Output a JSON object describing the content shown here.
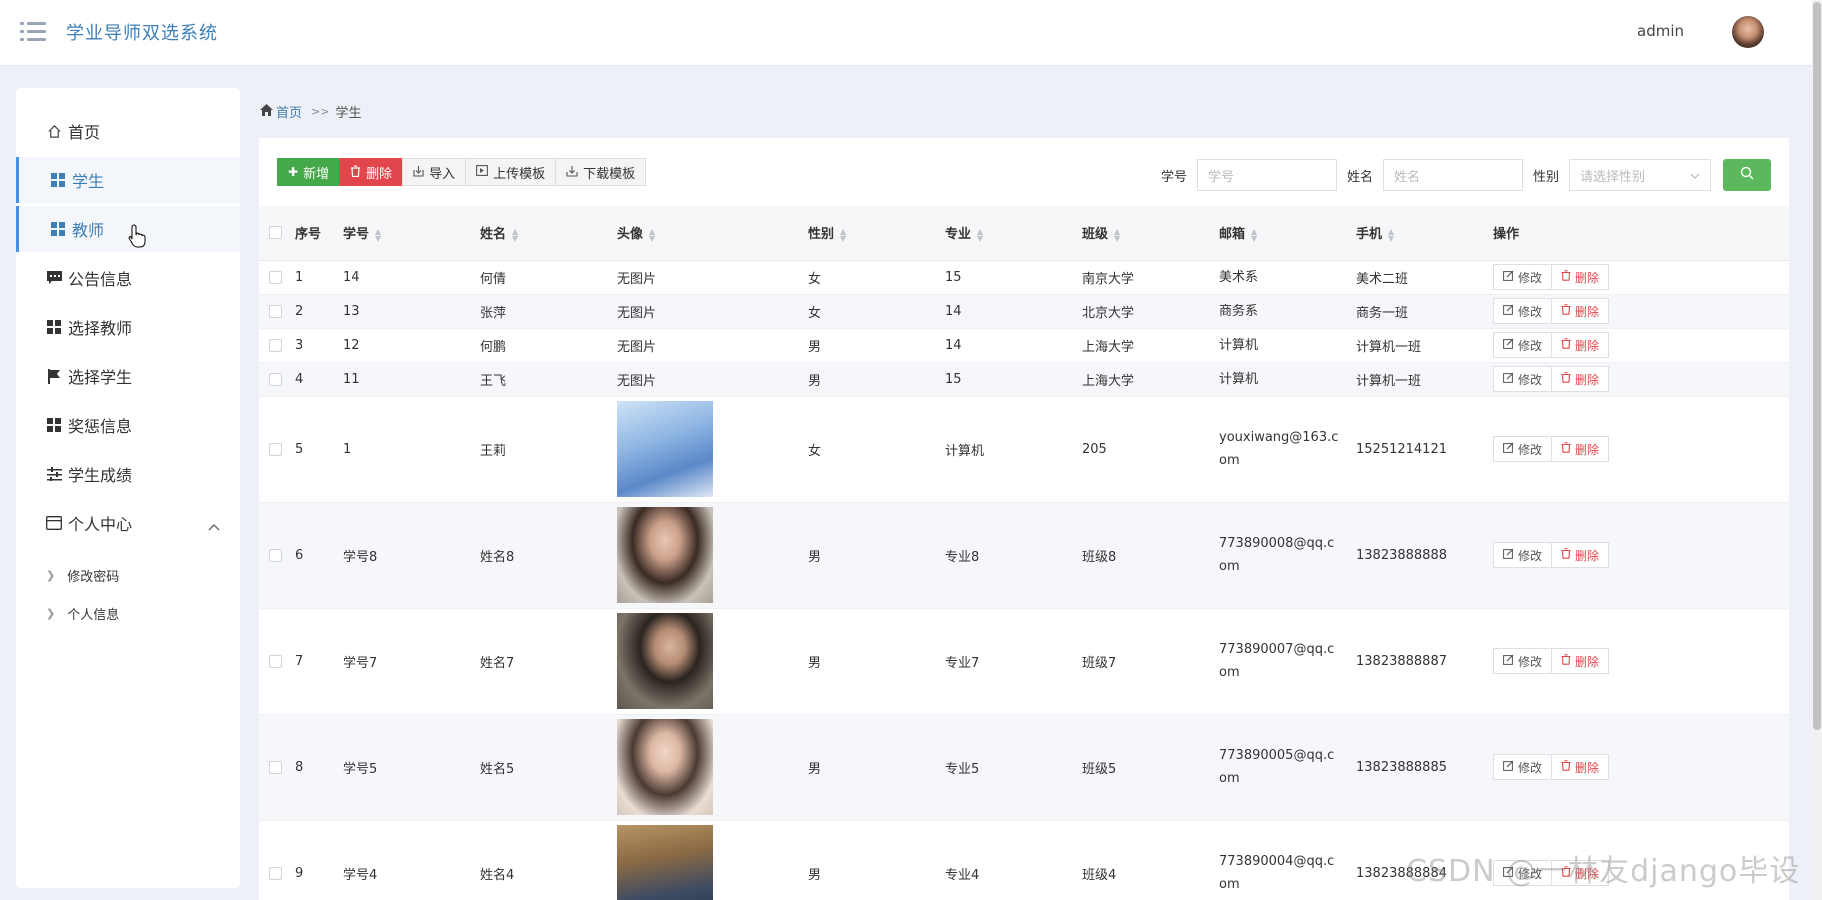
{
  "app": {
    "title": "学业导师双选系统",
    "user": "admin"
  },
  "sidebar": {
    "items": [
      {
        "label": "首页",
        "icon": "home-icon"
      },
      {
        "label": "学生",
        "icon": "grid-icon"
      },
      {
        "label": "教师",
        "icon": "grid-icon"
      },
      {
        "label": "公告信息",
        "icon": "comment-icon"
      },
      {
        "label": "选择教师",
        "icon": "grid-icon"
      },
      {
        "label": "选择学生",
        "icon": "flag-icon"
      },
      {
        "label": "奖惩信息",
        "icon": "grid-icon"
      },
      {
        "label": "学生成绩",
        "icon": "sliders-icon"
      },
      {
        "label": "个人中心",
        "icon": "card-icon"
      }
    ],
    "subitems": [
      "修改密码",
      "个人信息"
    ]
  },
  "breadcrumb": {
    "home": "首页",
    "sep": ">>",
    "current": "学生"
  },
  "toolbar": {
    "add": "新增",
    "delete": "删除",
    "import": "导入",
    "upload": "上传模板",
    "download": "下载模板"
  },
  "filters": {
    "id_label": "学号",
    "id_placeholder": "学号",
    "name_label": "姓名",
    "name_placeholder": "姓名",
    "gender_label": "性别",
    "gender_placeholder": "请选择性别"
  },
  "table": {
    "headers": {
      "no": "序号",
      "id": "学号",
      "name": "姓名",
      "avatar": "头像",
      "gender": "性别",
      "major": "专业",
      "class": "班级",
      "email": "邮箱",
      "phone": "手机",
      "ops": "操作"
    },
    "edit_label": "修改",
    "delete_label": "删除",
    "rows": [
      {
        "no": "1",
        "id": "14",
        "name": "何倩",
        "avatar": "无图片",
        "gender": "女",
        "major": "15",
        "class": "南京大学",
        "email": "美术系",
        "phone": "美术二班"
      },
      {
        "no": "2",
        "id": "13",
        "name": "张萍",
        "avatar": "无图片",
        "gender": "女",
        "major": "14",
        "class": "北京大学",
        "email": "商务系",
        "phone": "商务一班"
      },
      {
        "no": "3",
        "id": "12",
        "name": "何鹏",
        "avatar": "无图片",
        "gender": "男",
        "major": "14",
        "class": "上海大学",
        "email": "计算机",
        "phone": "计算机一班"
      },
      {
        "no": "4",
        "id": "11",
        "name": "王飞",
        "avatar": "无图片",
        "gender": "男",
        "major": "15",
        "class": "上海大学",
        "email": "计算机",
        "phone": "计算机一班"
      },
      {
        "no": "5",
        "id": "1",
        "name": "王莉",
        "avatar": "",
        "gender": "女",
        "major": "计算机",
        "class": "205",
        "email": "youxiwang@163.com",
        "phone": "15251214121"
      },
      {
        "no": "6",
        "id": "学号8",
        "name": "姓名8",
        "avatar": "",
        "gender": "男",
        "major": "专业8",
        "class": "班级8",
        "email": "773890008@qq.com",
        "phone": "13823888888"
      },
      {
        "no": "7",
        "id": "学号7",
        "name": "姓名7",
        "avatar": "",
        "gender": "男",
        "major": "专业7",
        "class": "班级7",
        "email": "773890007@qq.com",
        "phone": "13823888887"
      },
      {
        "no": "8",
        "id": "学号5",
        "name": "姓名5",
        "avatar": "",
        "gender": "男",
        "major": "专业5",
        "class": "班级5",
        "email": "773890005@qq.com",
        "phone": "13823888885"
      },
      {
        "no": "9",
        "id": "学号4",
        "name": "姓名4",
        "avatar": "",
        "gender": "男",
        "major": "专业4",
        "class": "班级4",
        "email": "773890004@qq.com",
        "phone": "13823888884"
      }
    ]
  },
  "watermark": "CSDN @一林友django毕设",
  "colors": {
    "brand": "#3f7fb7",
    "add": "#45a849",
    "delete": "#e0464b",
    "search": "#5cb85c"
  }
}
